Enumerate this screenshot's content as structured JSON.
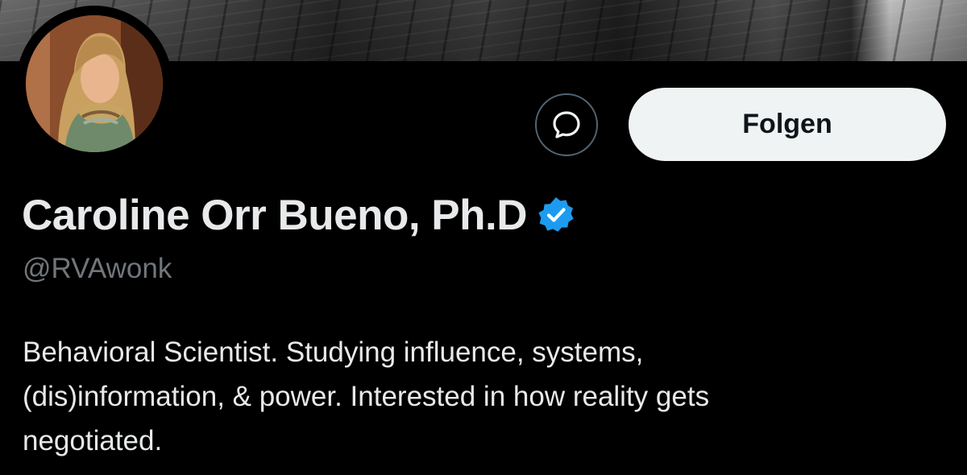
{
  "profile": {
    "display_name": "Caroline Orr Bueno, Ph.D",
    "handle": "@RVAwonk",
    "verified": true,
    "bio_lines": [
      "Behavioral Scientist. Studying influence, systems,",
      "(dis)information, & power. Interested in how reality gets",
      "negotiated."
    ]
  },
  "actions": {
    "follow_label": "Folgen",
    "message_icon": "message-bubble-icon"
  },
  "colors": {
    "background": "#000000",
    "text_primary": "#e7e9ea",
    "text_secondary": "#71767b",
    "follow_button_bg": "#eff3f4",
    "verified_badge": "#1d9bf0"
  }
}
